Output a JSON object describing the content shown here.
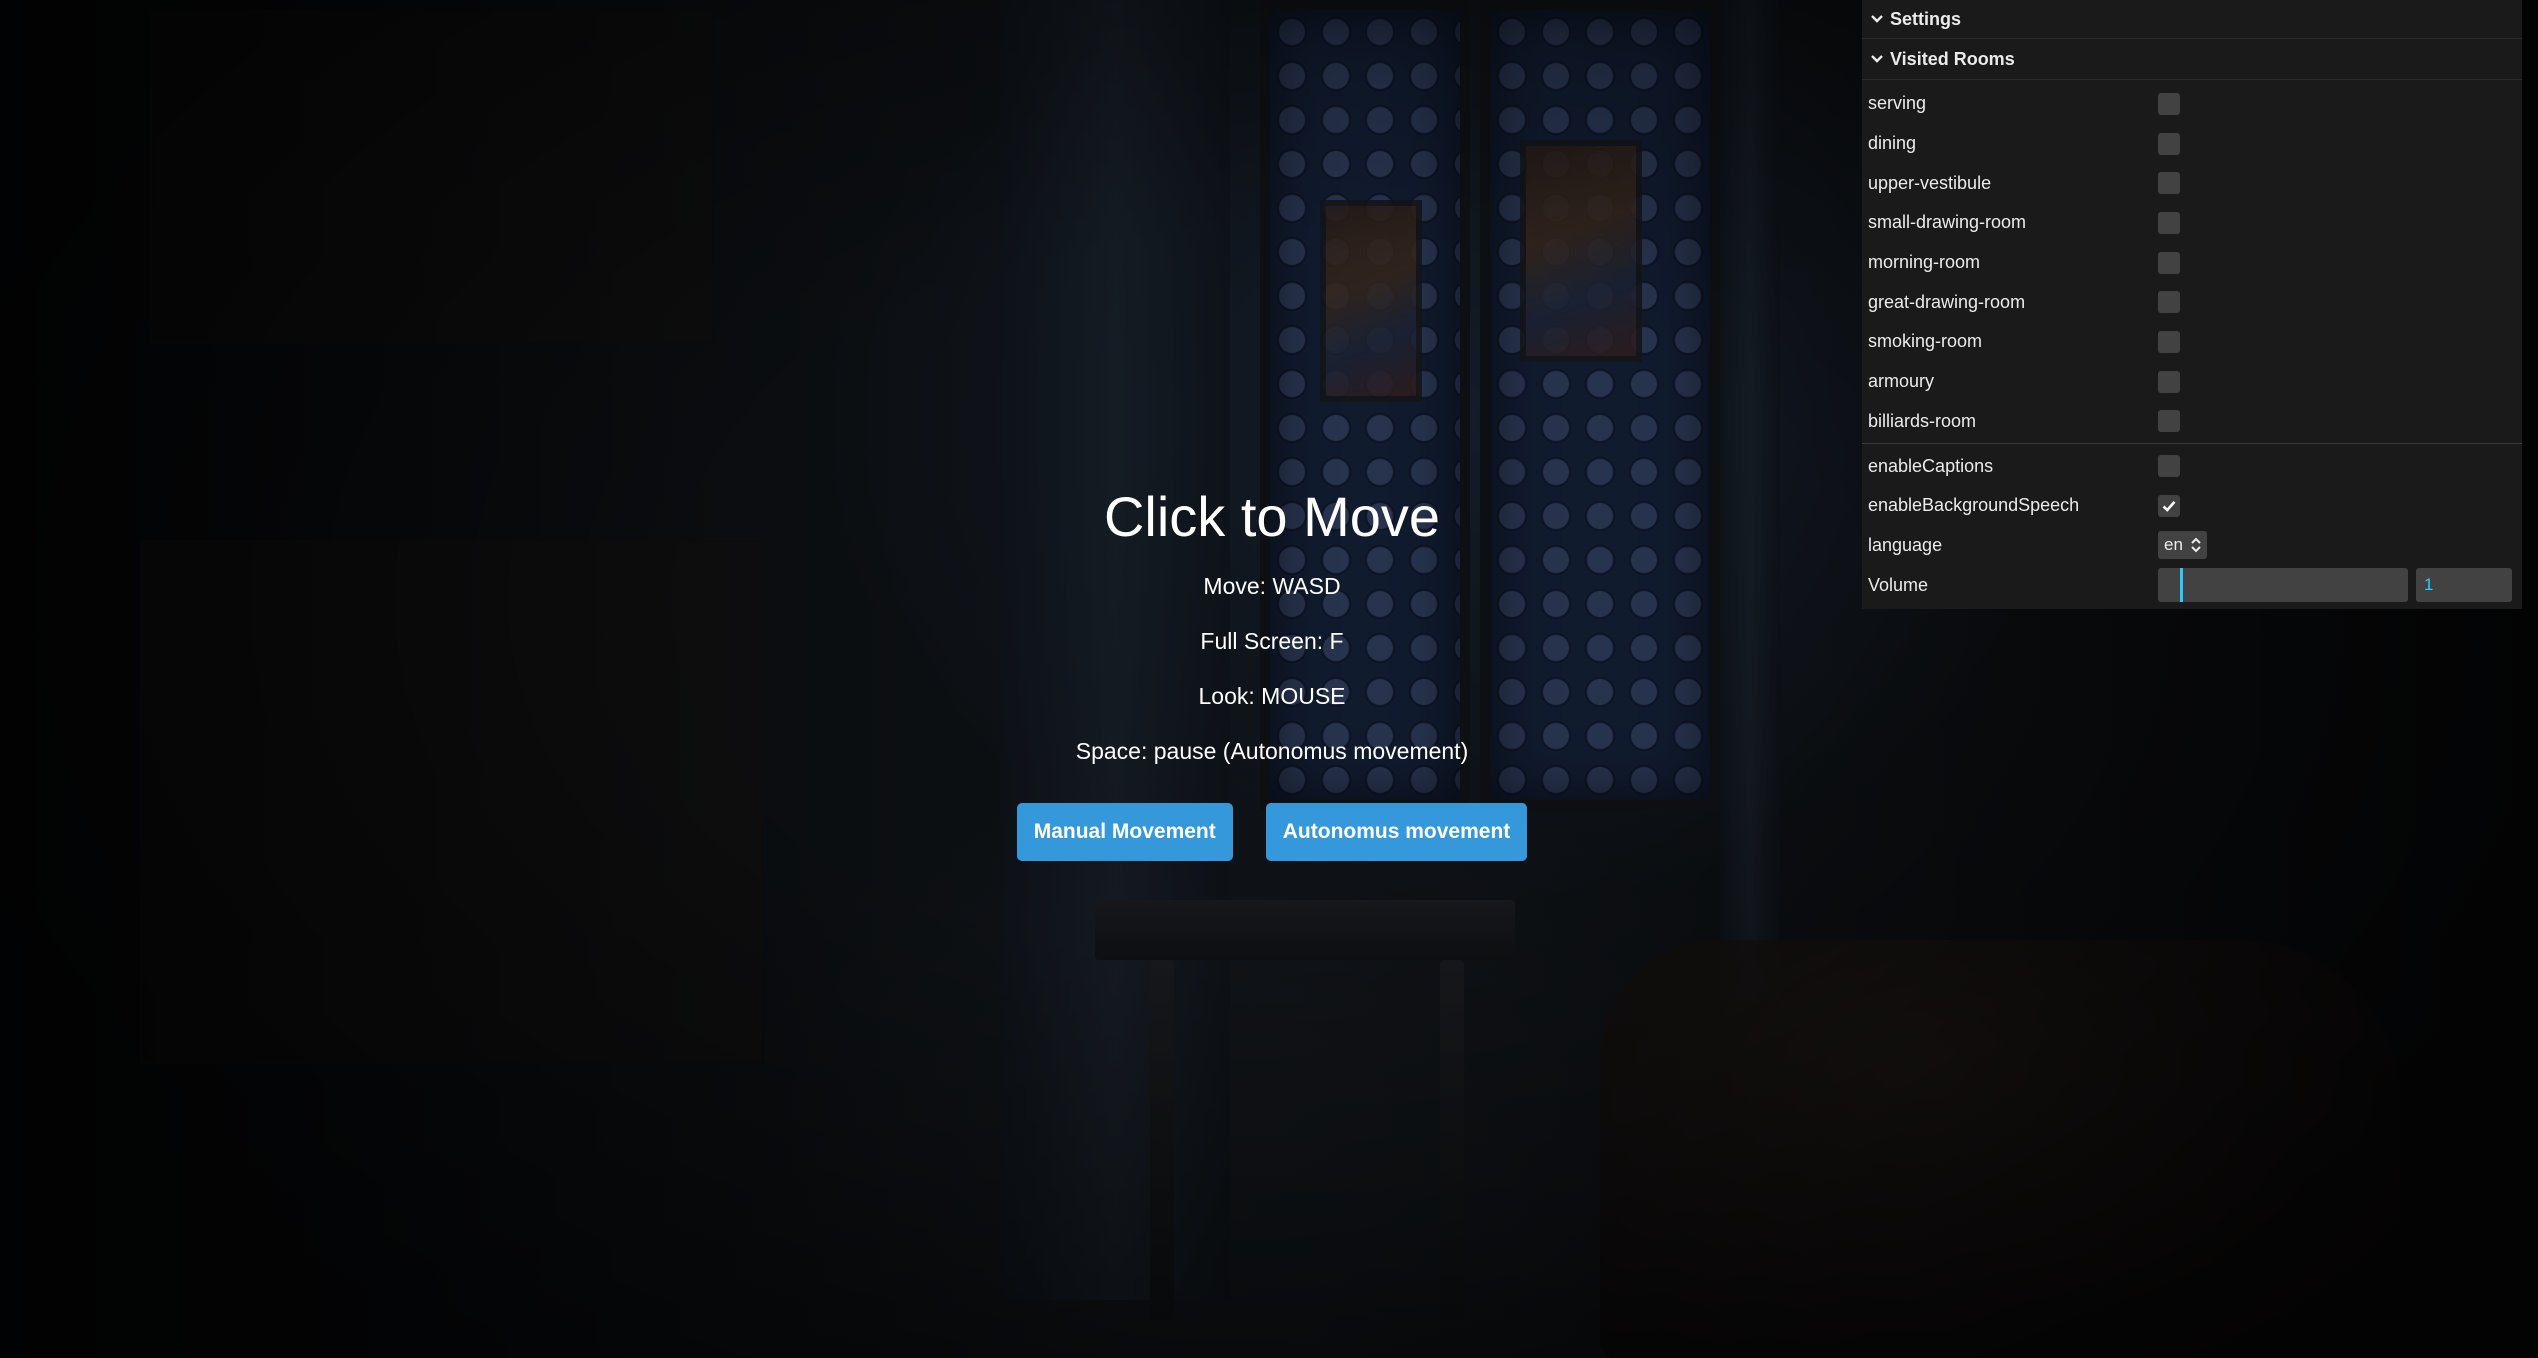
{
  "blocker": {
    "title": "Click to Move",
    "instructions": [
      "Move: WASD",
      "Full Screen: F",
      "Look: MOUSE",
      "Space: pause (Autonomus movement)"
    ],
    "buttons": {
      "manual": "Manual Movement",
      "autonomous": "Autonomus movement"
    },
    "button_color": "#3498db"
  },
  "gui": {
    "title": "Settings",
    "folder": {
      "title": "Visited Rooms",
      "rooms": [
        {
          "label": "serving",
          "checked": false
        },
        {
          "label": "dining",
          "checked": false
        },
        {
          "label": "upper-vestibule",
          "checked": false
        },
        {
          "label": "small-drawing-room",
          "checked": false
        },
        {
          "label": "morning-room",
          "checked": false
        },
        {
          "label": "great-drawing-room",
          "checked": false
        },
        {
          "label": "smoking-room",
          "checked": false
        },
        {
          "label": "armoury",
          "checked": false
        },
        {
          "label": "billiards-room",
          "checked": false
        }
      ]
    },
    "enableCaptions": {
      "label": "enableCaptions",
      "checked": false
    },
    "enableBackgroundSpeech": {
      "label": "enableBackgroundSpeech",
      "checked": true
    },
    "language": {
      "label": "language",
      "value": "en"
    },
    "volume": {
      "label": "Volume",
      "value": "1",
      "fraction": 0.0
    },
    "accent_color": "#2cc9ff"
  }
}
